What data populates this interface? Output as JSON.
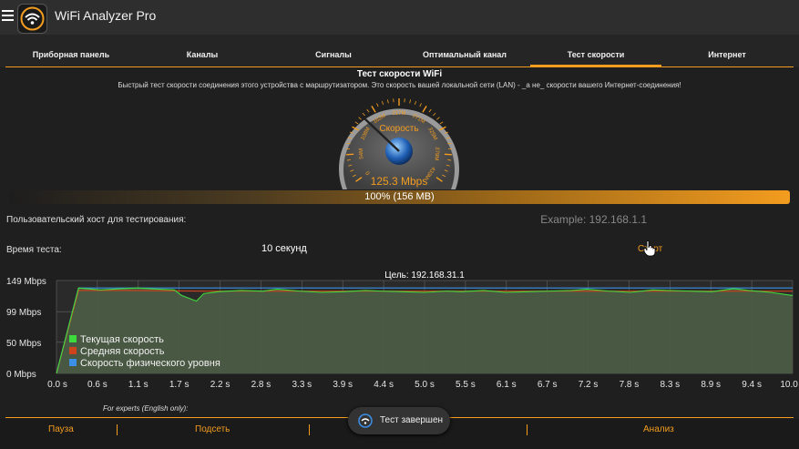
{
  "app": {
    "title": "WiFi Analyzer Pro"
  },
  "tabs": [
    {
      "label": "Приборная панель"
    },
    {
      "label": "Каналы"
    },
    {
      "label": "Сигналы"
    },
    {
      "label": "Оптимальный канал"
    },
    {
      "label": "Тест скорости",
      "active": true
    },
    {
      "label": "Интернет"
    }
  ],
  "page": {
    "title": "Тест скорости WiFi",
    "subtitle": "Быстрый тест скорости соединения этого устройства с маршрутизатором. Это скорость вашей локальной сети (LAN) - _а не_ скорости вашего Интернет-соединения!"
  },
  "gauge": {
    "center_label": "Скорость",
    "value_text": "125.3 Mbps",
    "scale_labels": [
      "0",
      "54M",
      "108M",
      "162M",
      "217M",
      "271M",
      "325M",
      "379M",
      "433M"
    ]
  },
  "progress": {
    "text": "100% (156 MB)",
    "percent": 100
  },
  "form": {
    "host_label": "Пользовательский хост для тестирования:",
    "host_placeholder": "Example: 192.168.1.1",
    "time_label": "Время теста:",
    "time_value": "10 секунд",
    "start_label": "Старт"
  },
  "chart_data": {
    "type": "line",
    "title": "Цель: 192.168.31.1",
    "y_tick_labels": [
      "149 Mbps",
      "99 Mbps",
      "50 Mbps",
      "0 Mbps"
    ],
    "x_tick_labels": [
      "0.0 s",
      "0.6 s",
      "1.1 s",
      "1.7 s",
      "2.2 s",
      "2.8 s",
      "3.3 s",
      "3.9 s",
      "4.4 s",
      "5.0 s",
      "5.5 s",
      "6.1 s",
      "6.7 s",
      "7.2 s",
      "7.8 s",
      "8.3 s",
      "8.9 s",
      "9.4 s",
      "10.0 s"
    ],
    "ylim": [
      0,
      149
    ],
    "xlim": [
      0,
      10
    ],
    "legend": [
      {
        "name": "Текущая скорость",
        "color": "#3ddc3d"
      },
      {
        "name": "Средняя скорость",
        "color": "#d0421b"
      },
      {
        "name": "Скорость физического уровня",
        "color": "#3b8fe6"
      }
    ],
    "series": [
      {
        "name": "Текущая скорость",
        "color": "#3ddc3d",
        "x": [
          0,
          0.3,
          0.6,
          0.9,
          1.1,
          1.4,
          1.6,
          1.7,
          1.9,
          2.0,
          2.2,
          2.5,
          2.8,
          3.0,
          3.3,
          3.6,
          3.9,
          4.2,
          4.4,
          4.7,
          5.0,
          5.3,
          5.5,
          5.8,
          6.1,
          6.4,
          6.7,
          7.0,
          7.2,
          7.5,
          7.8,
          8.1,
          8.3,
          8.6,
          8.9,
          9.2,
          9.4,
          9.7,
          10.0
        ],
        "y": [
          0,
          137,
          134,
          136,
          137,
          135,
          134,
          125,
          116,
          128,
          131,
          133,
          132,
          135,
          132,
          130,
          131,
          133,
          132,
          131,
          130,
          132,
          131,
          133,
          130,
          131,
          132,
          133,
          135,
          132,
          130,
          134,
          133,
          132,
          131,
          136,
          133,
          130,
          125
        ]
      },
      {
        "name": "Средняя скорость",
        "color": "#d0421b",
        "x": [
          0,
          0.3,
          1,
          2,
          3,
          4,
          5,
          6,
          7,
          8,
          9,
          10
        ],
        "y": [
          0,
          133,
          133,
          132,
          132,
          132,
          132,
          132,
          132,
          132,
          132,
          132
        ]
      },
      {
        "name": "Скорость физического уровня",
        "color": "#3b8fe6",
        "x": [
          0,
          0.3,
          10
        ],
        "y": [
          0,
          137,
          137
        ]
      }
    ]
  },
  "footer": {
    "experts_label": "For experts (English only):",
    "buttons": [
      "Пауза",
      "Подсеть",
      "Анализ"
    ]
  },
  "toast": {
    "text": "Тест завершен"
  },
  "colors": {
    "accent": "#f39c1f"
  }
}
